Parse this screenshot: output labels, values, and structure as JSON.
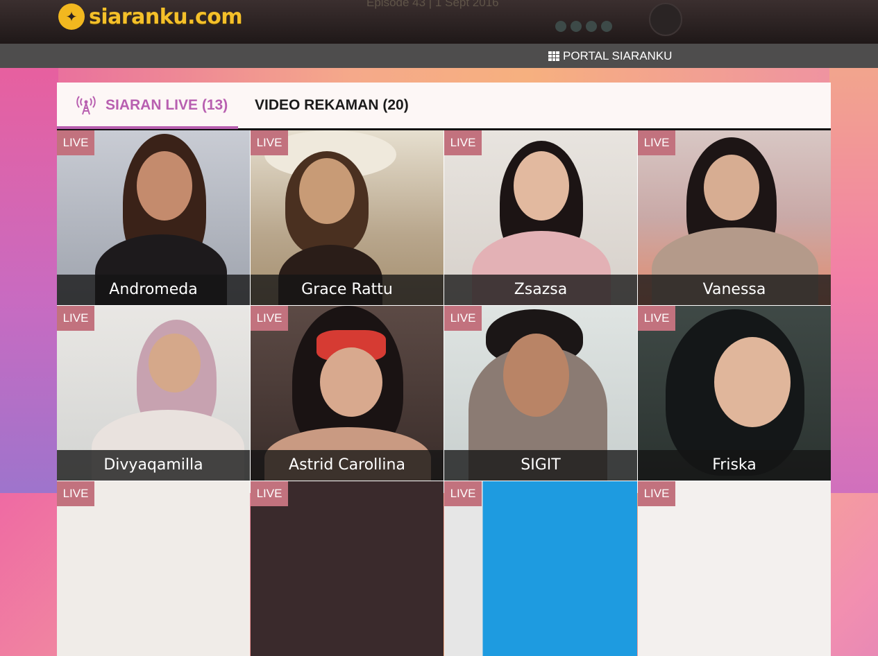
{
  "header": {
    "logo_text": "siaranku.com",
    "episode_text": "Episode 43 | 1 Sept 2016"
  },
  "portal": {
    "label": "PORTAL SIARANKU"
  },
  "tabs": [
    {
      "label": "SIARAN LIVE (13)",
      "active": true
    },
    {
      "label": "VIDEO REKAMAN (20)",
      "active": false
    }
  ],
  "live_badge": "LIVE",
  "colors": {
    "accent": "#b85fb0",
    "live_badge": "#c2727e",
    "logo": "#f4c02a"
  },
  "streams": [
    {
      "name": "Andromeda"
    },
    {
      "name": "Grace Rattu"
    },
    {
      "name": "Zsazsa"
    },
    {
      "name": "Vanessa"
    },
    {
      "name": "Divyaqamilla"
    },
    {
      "name": "Astrid Carollina"
    },
    {
      "name": "SIGIT"
    },
    {
      "name": "Friska"
    },
    {
      "name": ""
    },
    {
      "name": ""
    },
    {
      "name": ""
    },
    {
      "name": ""
    }
  ]
}
